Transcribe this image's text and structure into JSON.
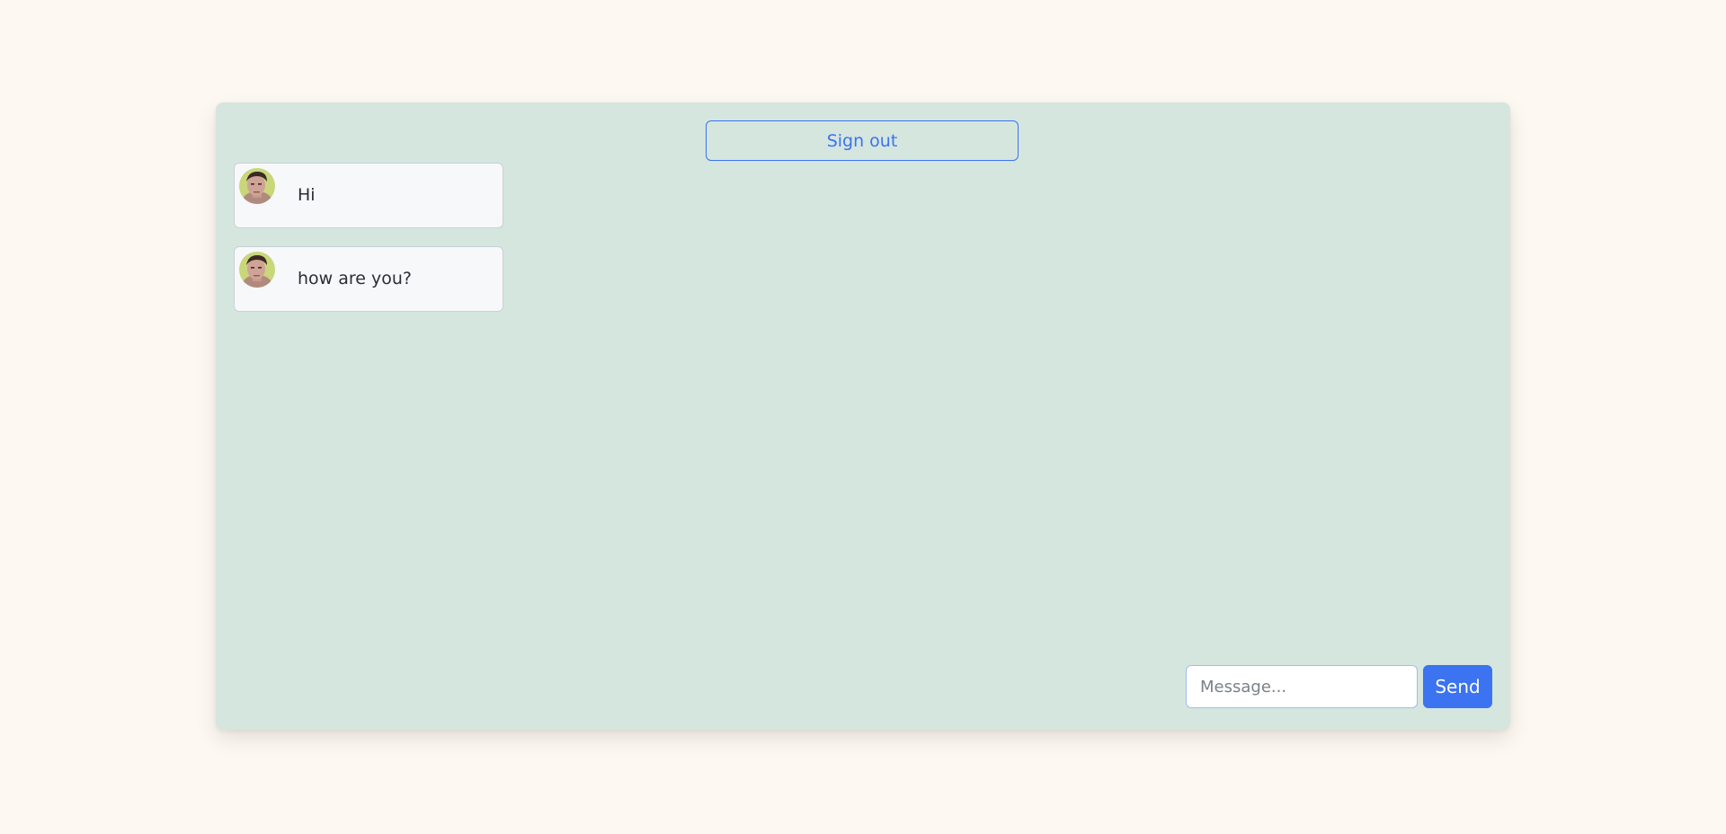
{
  "header": {
    "signout_label": "Sign out"
  },
  "messages": [
    {
      "text": "Hi",
      "avatar_icon": "user-avatar"
    },
    {
      "text": "how are you?",
      "avatar_icon": "user-avatar"
    }
  ],
  "composer": {
    "placeholder": "Message...",
    "send_label": "Send"
  },
  "colors": {
    "page_background": "#fdf8f1",
    "card_background": "#d5e6df",
    "accent": "#3b73f0",
    "bubble_background": "#f7f8fa"
  }
}
